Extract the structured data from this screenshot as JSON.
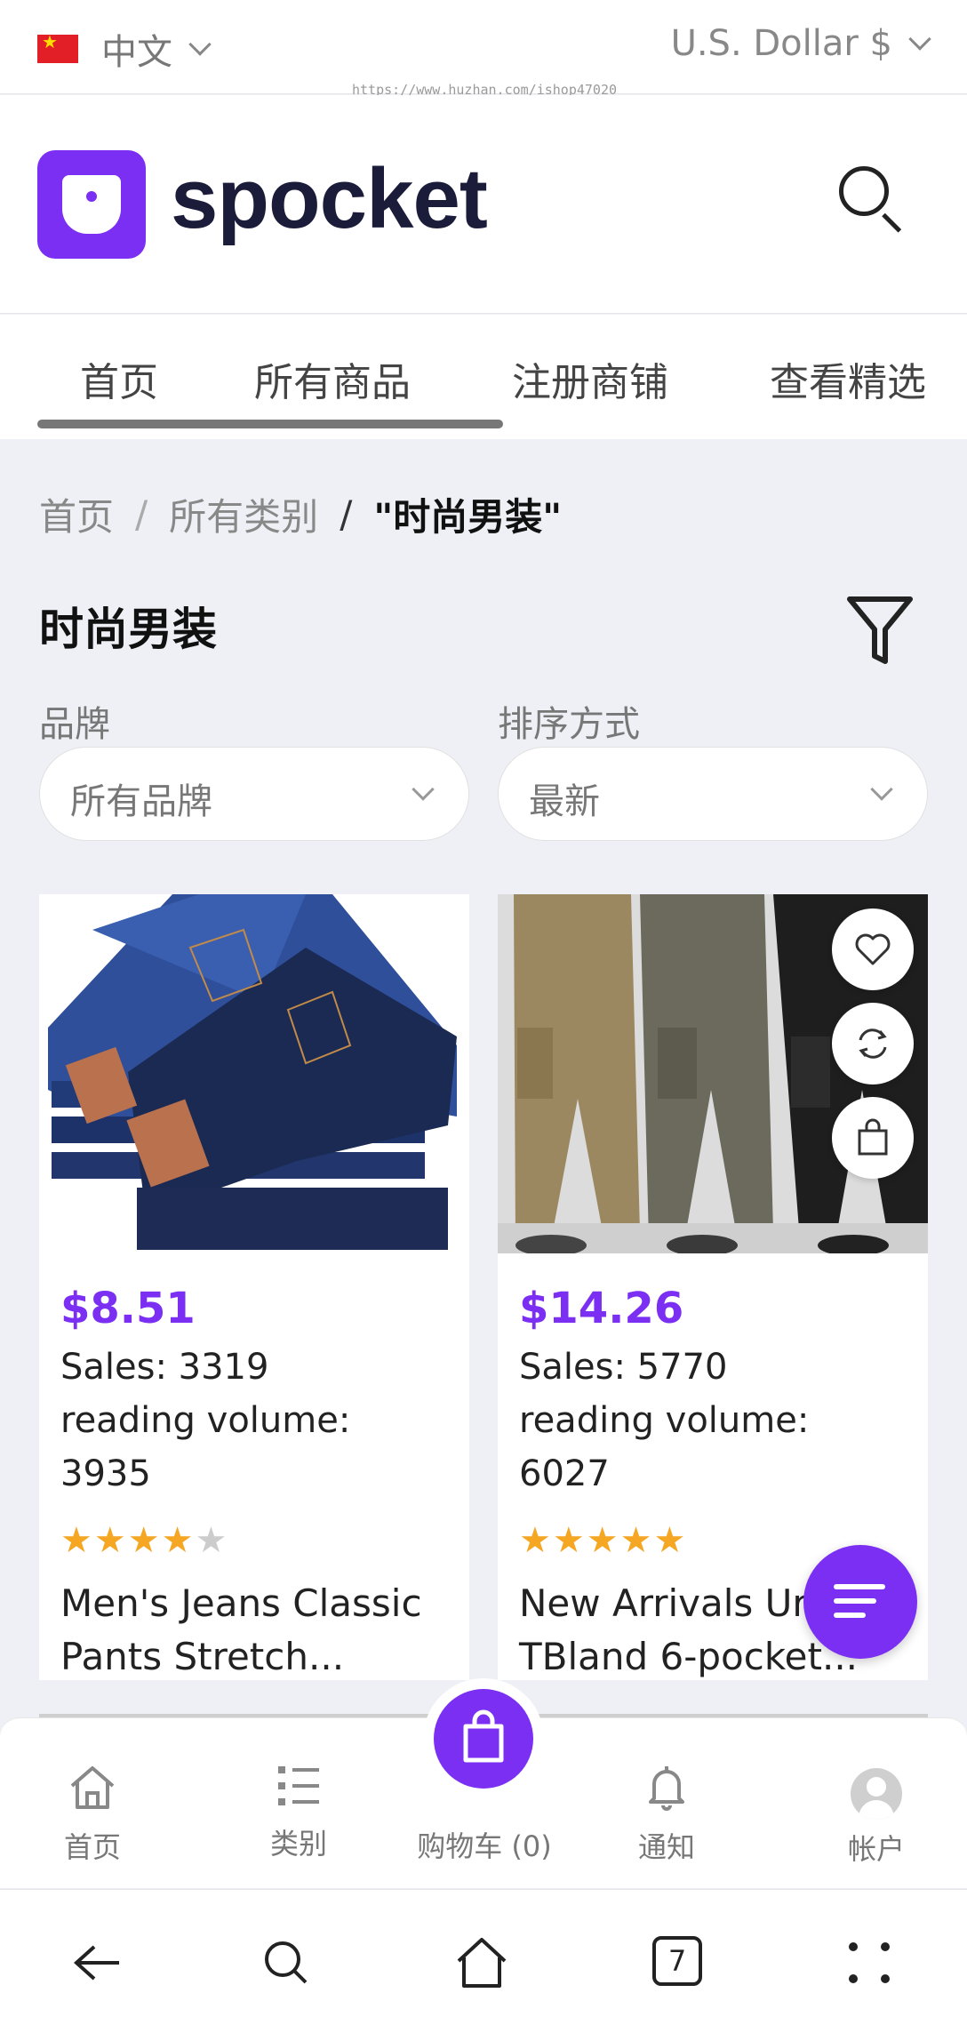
{
  "topbar": {
    "language": "中文",
    "currency": "U.S. Dollar $",
    "url_watermark": "https://www.huzhan.com/ishop47020"
  },
  "header": {
    "brand": "spocket"
  },
  "nav": {
    "tabs": [
      "首页",
      "所有商品",
      "注册商铺",
      "查看精选"
    ],
    "active_index": 0
  },
  "breadcrumb": {
    "items": [
      "首页",
      "所有类别"
    ],
    "separator": "/",
    "current": "\"时尚男装\""
  },
  "page": {
    "title": "时尚男装"
  },
  "filters": {
    "brand_label": "品牌",
    "brand_value": "所有品牌",
    "sort_label": "排序方式",
    "sort_value": "最新"
  },
  "products": [
    {
      "price": "$8.51",
      "sales": "Sales:   3319",
      "reading_volume_label": "reading volume:",
      "reading_volume": "3935",
      "rating": 4.5,
      "title_line1": "Men's Jeans Classic",
      "title_line2": "Pants Stretch..."
    },
    {
      "price": "$14.26",
      "sales": "Sales:   5770",
      "reading_volume_label": "reading volume:",
      "reading_volume": "6027",
      "rating": 5,
      "title_line1": "New Arrivals Ur",
      "title_line2": "TBland 6-pocket..."
    }
  ],
  "tabbar": {
    "home": "首页",
    "category": "类别",
    "cart": "购物车 (0)",
    "notify": "通知",
    "account": "帐户"
  },
  "system": {
    "tabs_count": "7"
  },
  "colors": {
    "accent": "#7b2ff2",
    "star": "#f5a623"
  }
}
